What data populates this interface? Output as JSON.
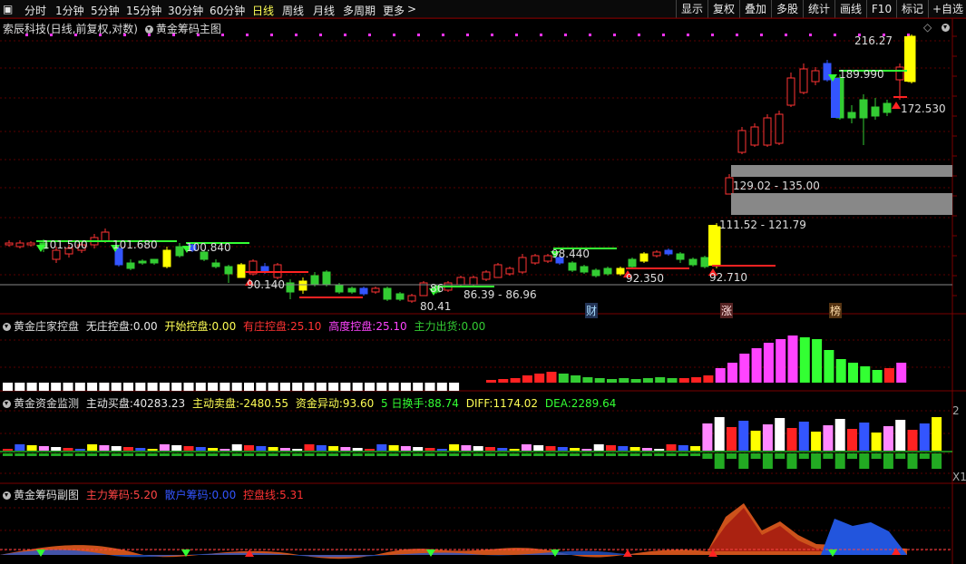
{
  "toolbar": {
    "periods": [
      "分时",
      "1分钟",
      "5分钟",
      "15分钟",
      "30分钟",
      "60分钟",
      "日线",
      "周线",
      "月线",
      "多周期",
      "更多"
    ],
    "active": "日线",
    "right_buttons": [
      "显示",
      "复权",
      "叠加",
      "多股",
      "统计",
      "画线",
      "F10",
      "标记",
      "+自选"
    ]
  },
  "main_panel": {
    "stock": "索辰科技(日线,前复权,对数)",
    "indicator": "黄金筹码主图",
    "price_labels": [
      "216.27",
      "189.990",
      "172.530",
      "129.02 - 135.00",
      "111.52 - 121.79",
      "101.500",
      "101.680",
      "100.840",
      "98.440",
      "92.350",
      "92.710",
      "90.140",
      "86.39 - 86.96",
      "80.41",
      "86"
    ],
    "markers": [
      "财",
      "涨",
      "榜"
    ]
  },
  "panel2": {
    "name": "黄金庄家控盘",
    "items": [
      {
        "label": "无庄控盘:",
        "value": "0.00",
        "color": "#e8e8e8"
      },
      {
        "label": "开始控盘:",
        "value": "0.00",
        "color": "#ffff55"
      },
      {
        "label": "有庄控盘:",
        "value": "25.10",
        "color": "#ff3333"
      },
      {
        "label": "高度控盘:",
        "value": "25.10",
        "color": "#ff44ff"
      },
      {
        "label": "主力出货:",
        "value": "0.00",
        "color": "#33cc33"
      }
    ]
  },
  "panel3": {
    "name": "黄金资金监测",
    "items": [
      {
        "label": "主动买盘:",
        "value": "40283.23",
        "color": "#e8e8e8"
      },
      {
        "label": "主动卖盘:",
        "value": "-2480.55",
        "color": "#ffff55"
      },
      {
        "label": "资金异动:",
        "value": "93.60",
        "color": "#ffff55"
      },
      {
        "label": "5 日换手:",
        "value": "88.74",
        "color": "#33ff33"
      },
      {
        "label": "DIFF:",
        "value": "1174.02",
        "color": "#ffff55"
      },
      {
        "label": "DEA:",
        "value": "2289.64",
        "color": "#33ff33"
      }
    ],
    "side_tick": "2",
    "corner": "X1"
  },
  "panel4": {
    "name": "黄金筹码副图",
    "items": [
      {
        "label": "主力筹码:",
        "value": "5.20",
        "color": "#ff4444"
      },
      {
        "label": "散户筹码:",
        "value": "0.00",
        "color": "#3355ff"
      },
      {
        "label": "控盘线:",
        "value": "5.31",
        "color": "#ff3333"
      }
    ]
  },
  "colors": {
    "up": "#ff3333",
    "down": "#33cc33",
    "bg": "#000000",
    "grid": "#5a0000",
    "text": "#e8e8e8"
  }
}
